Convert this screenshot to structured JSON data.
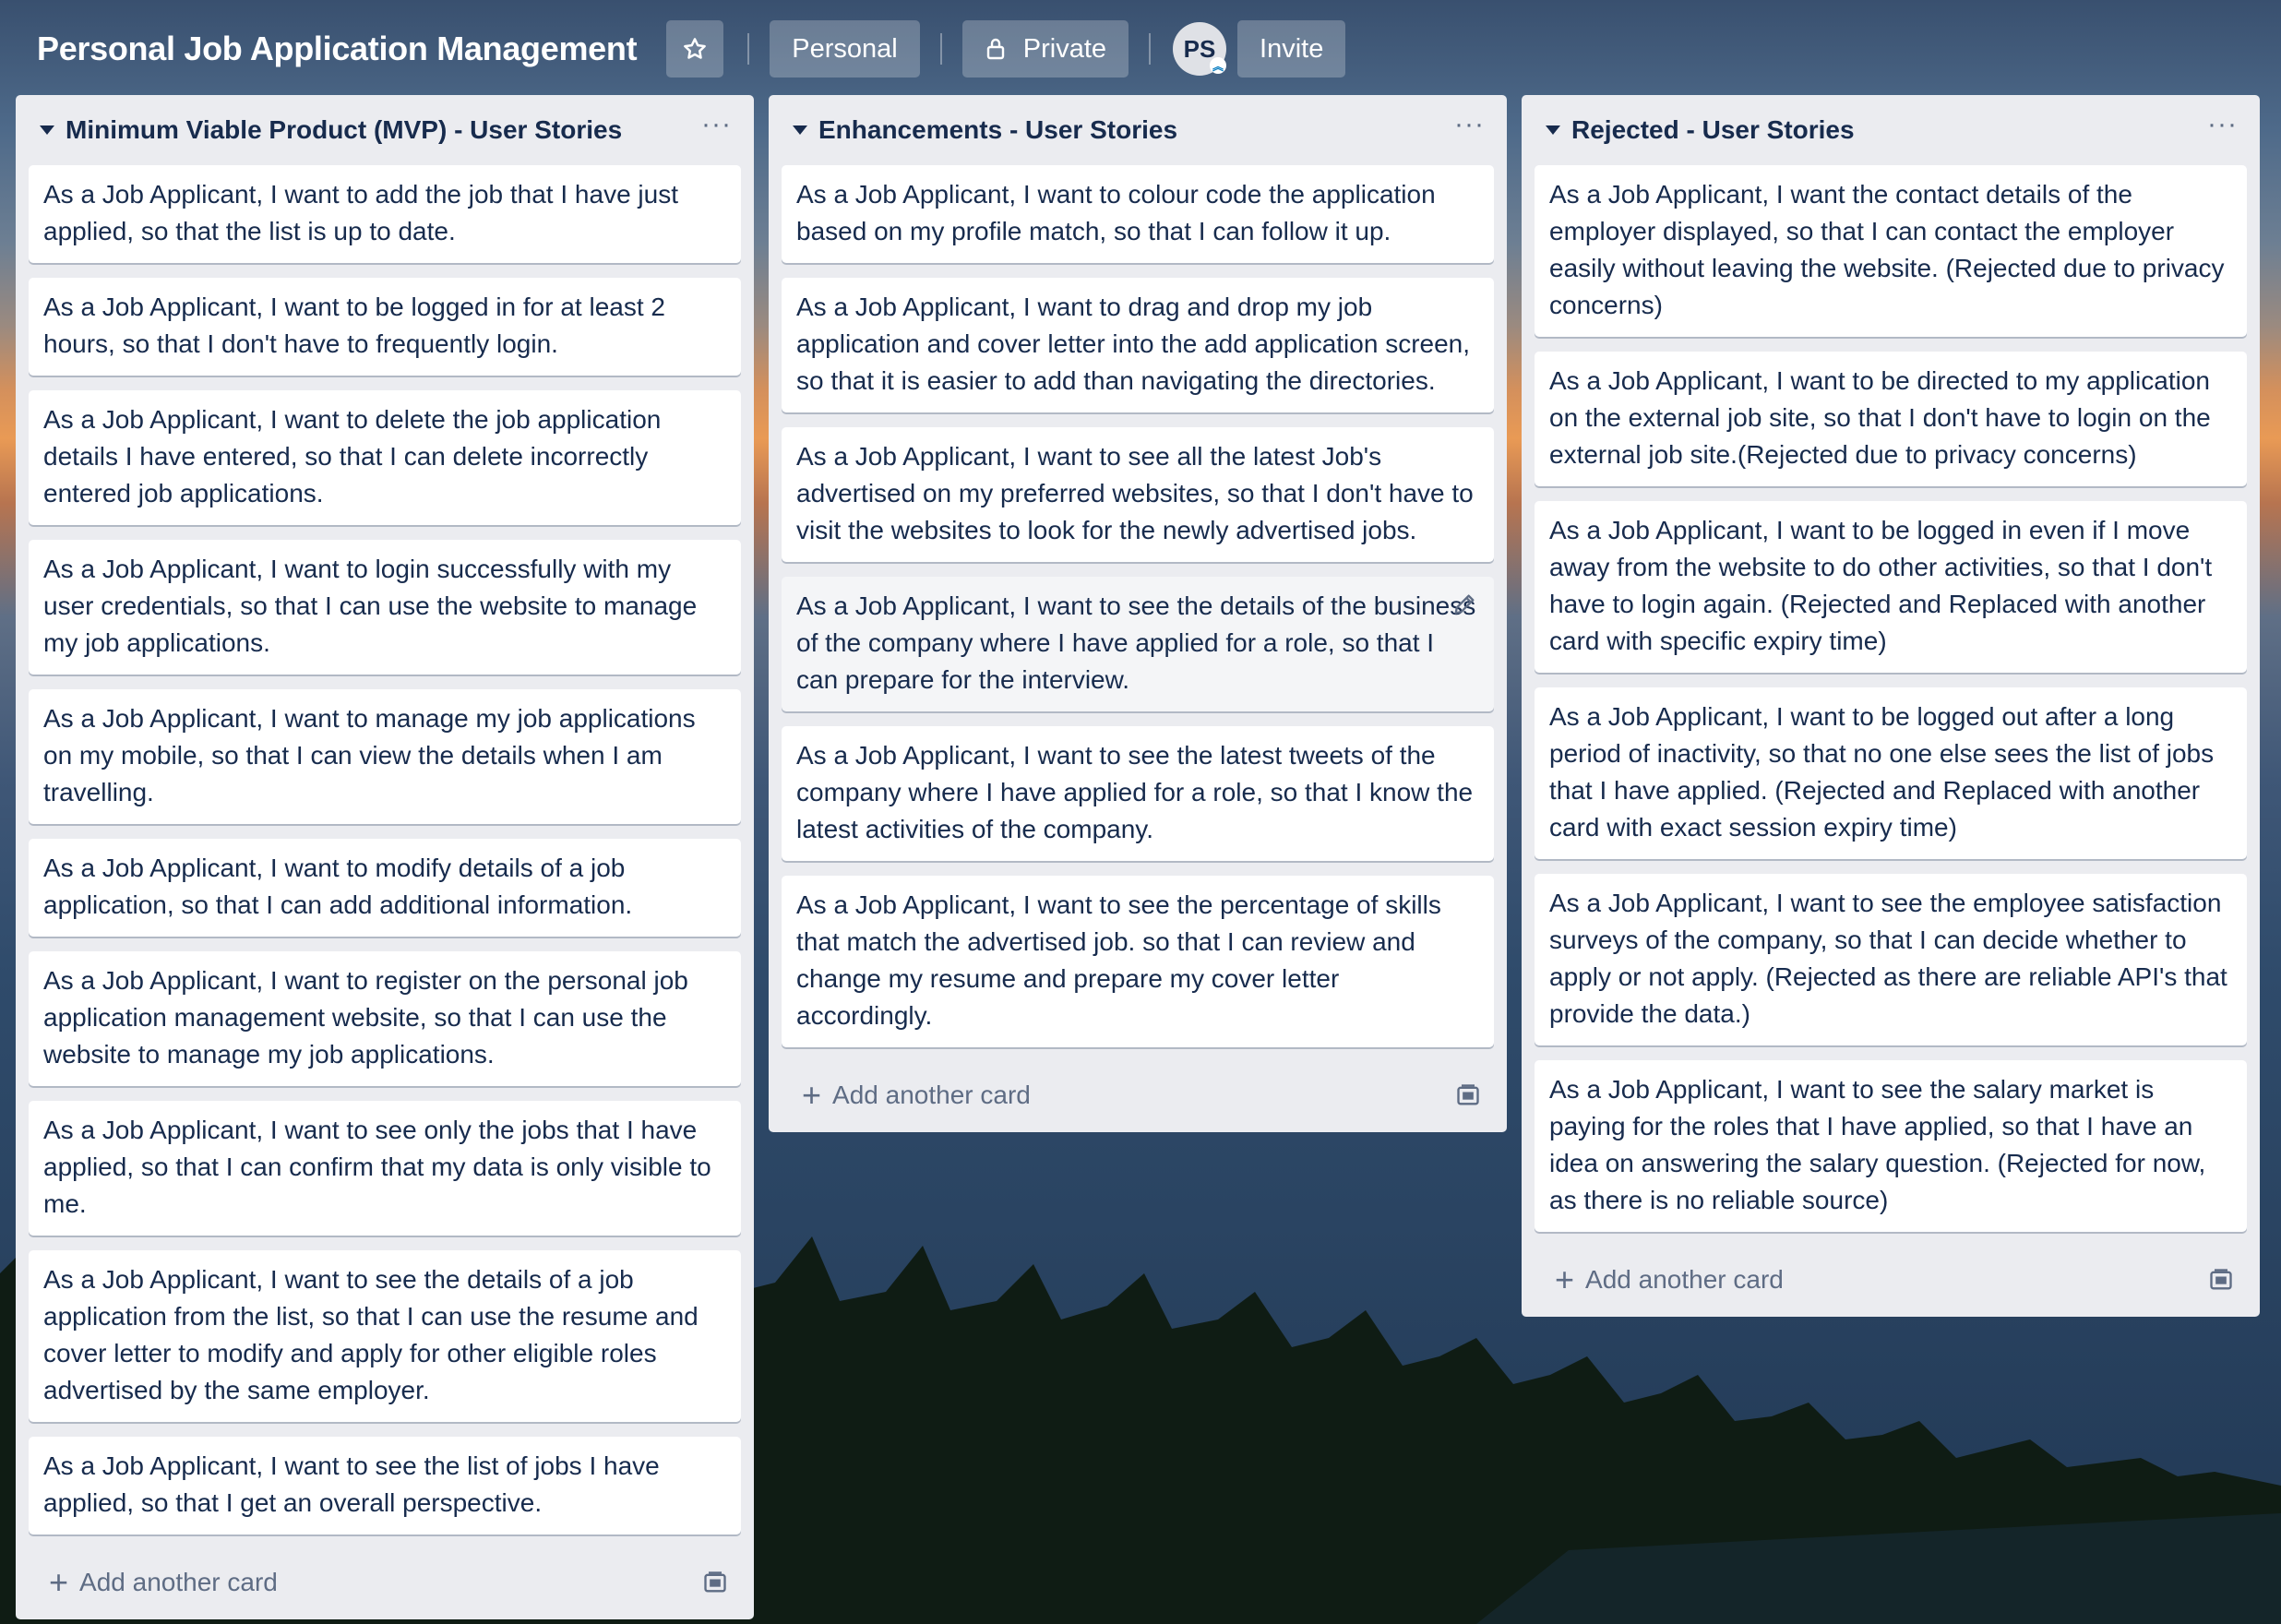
{
  "header": {
    "board_title": "Personal Job Application Management",
    "personal_label": "Personal",
    "private_label": "Private",
    "avatar_initials": "PS",
    "invite_label": "Invite"
  },
  "lists": [
    {
      "title": "Minimum Viable Product (MVP) - User Stories",
      "cards": [
        "As a Job Applicant, I want to add the job that I have just applied, so that the list is up to date.",
        "As a Job Applicant, I want to be logged in for at least 2 hours, so that I don't have to frequently login.",
        "As a Job Applicant, I want to delete the job application details I have entered, so that I can delete incorrectly entered job applications.",
        "As a Job Applicant, I want to login successfully with my user credentials, so that I can use the website to manage my job applications.",
        "As a Job Applicant, I want to manage my job applications on my mobile, so that I can view the details when I am travelling.",
        "As a Job Applicant, I want to modify details of a job application, so that I can add additional information.",
        "As a Job Applicant, I want to register on the personal job application management website, so that I can use the website to manage my job applications.",
        "As a Job Applicant, I want to see only the jobs that I have applied, so that I can confirm that my data is only visible to me.",
        "As a Job Applicant, I want to see the details of a job application from the list, so that I can use the resume and cover letter to modify and apply for other eligible roles advertised by the same employer.",
        "As a Job Applicant, I want to see the list of jobs I have applied, so that I get an overall perspective."
      ],
      "add_card_label": "Add another card"
    },
    {
      "title": "Enhancements - User Stories",
      "cards": [
        "As a Job Applicant, I want to colour code the application based on my profile match, so that I can follow it up.",
        "As a Job Applicant, I want to drag and drop my job application and cover letter into the add application screen, so that it is easier to add than navigating the directories.",
        "As a Job Applicant, I want to see all the latest Job's advertised on my preferred websites, so that I don't have to visit the websites to look for the newly advertised jobs.",
        "As a Job Applicant, I want to see the details of the business of the company where I have applied for a role, so that I can prepare for the interview.",
        "As a Job Applicant, I want to see the latest tweets of the company where I have applied for a role, so that I know the latest activities of the company.",
        "As a Job Applicant, I want to see the percentage of skills that match the advertised job. so that I can review and change my resume and prepare my cover letter accordingly."
      ],
      "add_card_label": "Add another card"
    },
    {
      "title": "Rejected - User Stories",
      "cards": [
        "As a Job Applicant, I want the contact details of the employer displayed, so that I can contact the employer easily without leaving the website. (Rejected due to privacy concerns)",
        "As a Job Applicant, I want to be directed to my application on the external job site, so that I don't have to login on the external job site.(Rejected due to privacy concerns)",
        "As a Job Applicant, I want to be logged in even if I move away from the website to do other activities, so that I don't have to login again. (Rejected and Replaced with another card with specific expiry time)",
        "As a Job Applicant, I want to be logged out after a long period of inactivity, so that no one else sees the list of jobs that I have applied. (Rejected and Replaced with another card with exact session expiry time)",
        "As a Job Applicant, I want to see the employee satisfaction surveys of the company, so that I can decide whether to apply or not apply. (Rejected as there are reliable API's that provide the data.)",
        "As a Job Applicant, I want to see the salary market is paying for the roles that I have applied, so that I have an idea on answering the salary question. (Rejected for now, as there is no reliable source)"
      ],
      "add_card_label": "Add another card"
    }
  ]
}
